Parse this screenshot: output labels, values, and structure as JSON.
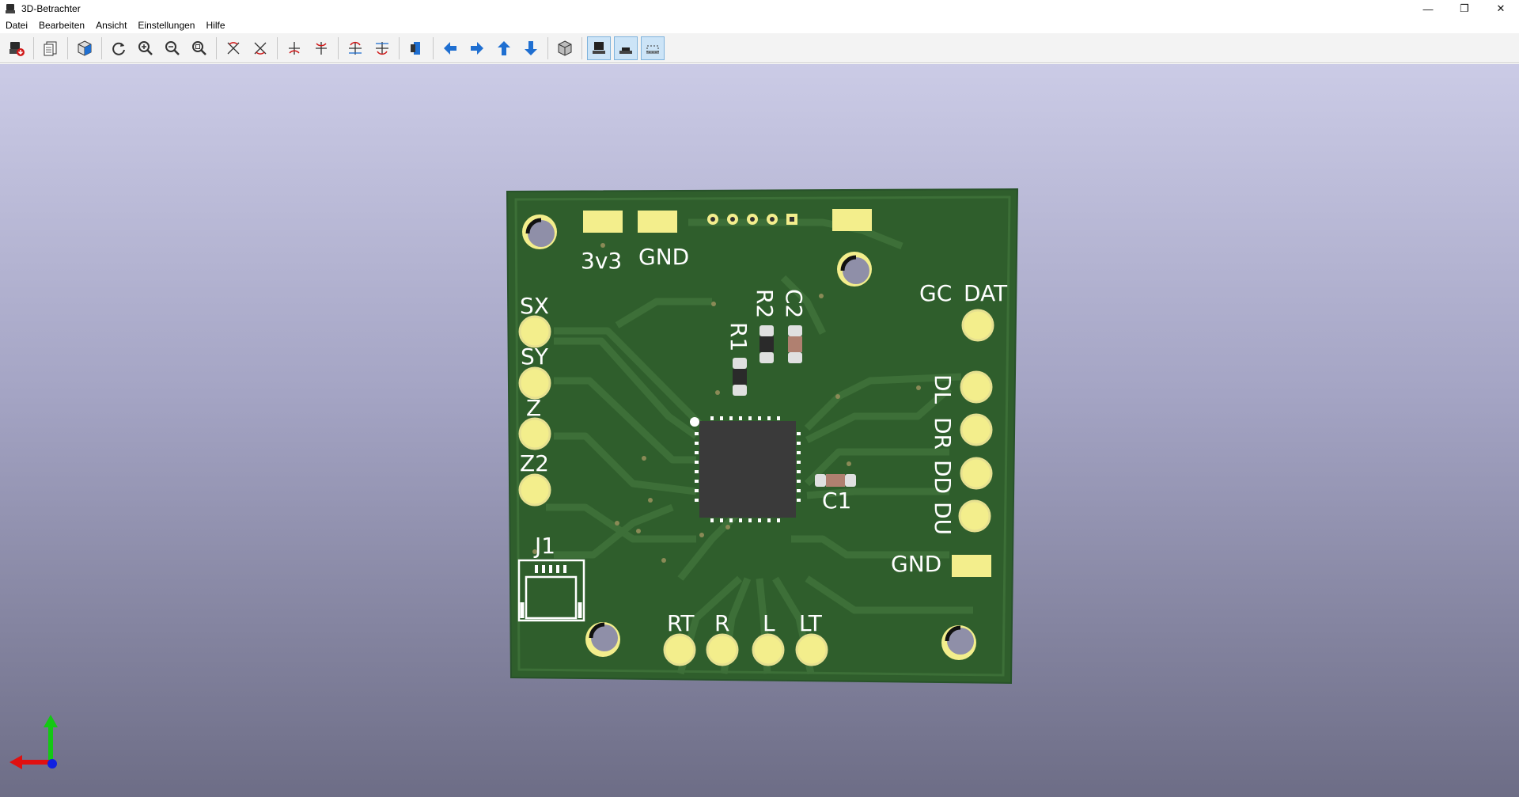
{
  "window": {
    "title": "3D-Betrachter",
    "controls": {
      "minimize": "—",
      "restore": "❐",
      "close": "✕"
    }
  },
  "menu": [
    "Datei",
    "Bearbeiten",
    "Ansicht",
    "Einstellungen",
    "Hilfe"
  ],
  "toolbar": {
    "groups": [
      [
        "export-icon"
      ],
      [
        "copy-icon"
      ],
      [
        "3d-settings-icon"
      ],
      [
        "redraw-icon",
        "zoom-in-icon",
        "zoom-out-icon",
        "zoom-fit-icon"
      ],
      [
        "rotate-x-cw-icon",
        "rotate-x-ccw-icon"
      ],
      [
        "rotate-y-cw-icon",
        "rotate-y-ccw-icon"
      ],
      [
        "rotate-z-cw-icon",
        "rotate-z-ccw-icon"
      ],
      [
        "flip-board-icon"
      ],
      [
        "pan-left-icon",
        "pan-right-icon",
        "pan-up-icon",
        "pan-down-icon"
      ],
      [
        "ortho-view-icon"
      ],
      [
        "show-tht-icon",
        "show-smd-icon",
        "show-virtual-icon"
      ]
    ]
  },
  "board": {
    "labels": {
      "pad_3v3": "3v3",
      "pad_gnd_top": "GND",
      "left_pins": [
        "SX",
        "SY",
        "Z",
        "Z2"
      ],
      "right_top": [
        "GC",
        "DAT"
      ],
      "right_pins": [
        "DL",
        "DR",
        "DD",
        "DU"
      ],
      "gnd_right": "GND",
      "bottom_pins": [
        "RT",
        "R",
        "L",
        "LT"
      ],
      "connector": "J1",
      "r1": "R1",
      "r2": "R2",
      "c2": "C2",
      "c1": "C1"
    },
    "colors": {
      "board": "#2f5e2c",
      "board_edge": "#3c6f37",
      "trace": "#3d6f38",
      "pad_gold": "#f3ee8c",
      "silkscreen": "#ffffff",
      "chip": "#3a3a3a"
    }
  },
  "axes": {
    "x_color": "#e01010",
    "y_color": "#14c814",
    "z_color": "#1020e0"
  }
}
